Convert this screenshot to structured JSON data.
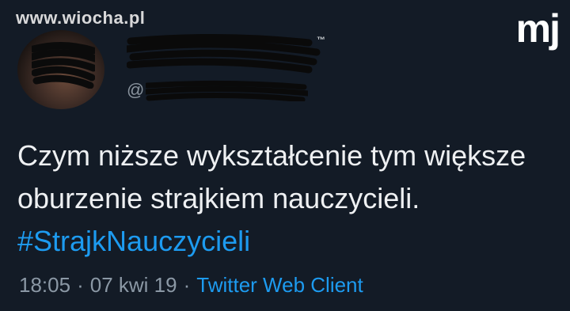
{
  "watermark": "www.wiocha.pl",
  "brand_logo": "mj",
  "author": {
    "trademark": "™",
    "handle_prefix": "@"
  },
  "tweet": {
    "text": "Czym niższe wykształcenie tym większe oburzenie strajkiem nauczycieli. ",
    "hashtag": "#StrajkNauczycieli"
  },
  "meta": {
    "time": "18:05",
    "sep1": "·",
    "date": "07 kwi 19",
    "sep2": "·",
    "client": "Twitter Web Client"
  },
  "colors": {
    "background": "#131b26",
    "link": "#1d9bf0",
    "muted": "#8b98a5"
  }
}
